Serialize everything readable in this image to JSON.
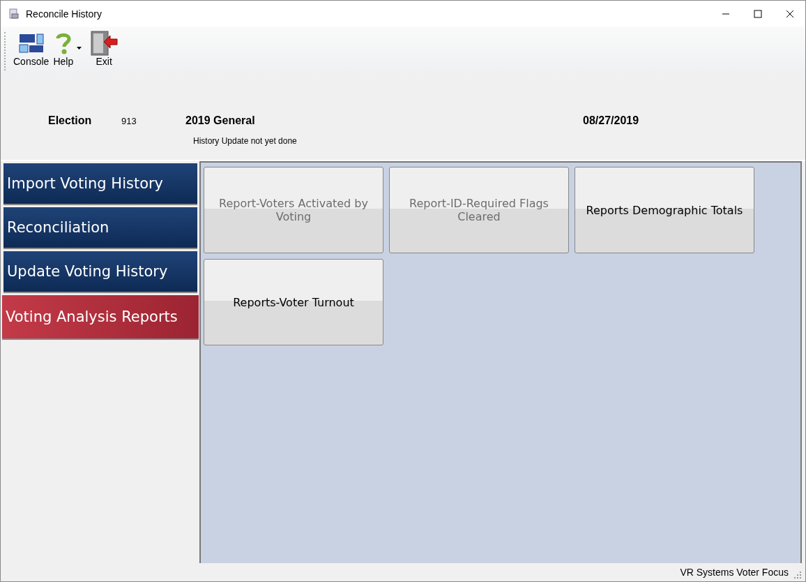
{
  "window": {
    "title": "Reconcile History"
  },
  "toolbar": [
    {
      "kind": "console",
      "label": "Console"
    },
    {
      "kind": "help",
      "label": "Help"
    },
    {
      "kind": "dropdown"
    },
    {
      "kind": "exit",
      "label": "Exit"
    }
  ],
  "election": {
    "label": "Election",
    "number": "913",
    "name": "2019 General",
    "date": "08/27/2019",
    "status": "History Update not yet done"
  },
  "nav": [
    {
      "label": "Import Voting History",
      "selected": false
    },
    {
      "label": "Reconciliation",
      "selected": false
    },
    {
      "label": "Update Voting History",
      "selected": false
    },
    {
      "label": "Voting Analysis Reports",
      "selected": true
    }
  ],
  "tiles": [
    {
      "label": "Report-Voters Activated by Voting",
      "disabled": true
    },
    {
      "label": "Report-ID-Required Flags Cleared",
      "disabled": true
    },
    {
      "label": "Reports Demographic Totals",
      "disabled": false
    },
    {
      "label": "Reports-Voter Turnout",
      "disabled": false
    }
  ],
  "status_bar": {
    "text": "VR Systems Voter Focus"
  }
}
